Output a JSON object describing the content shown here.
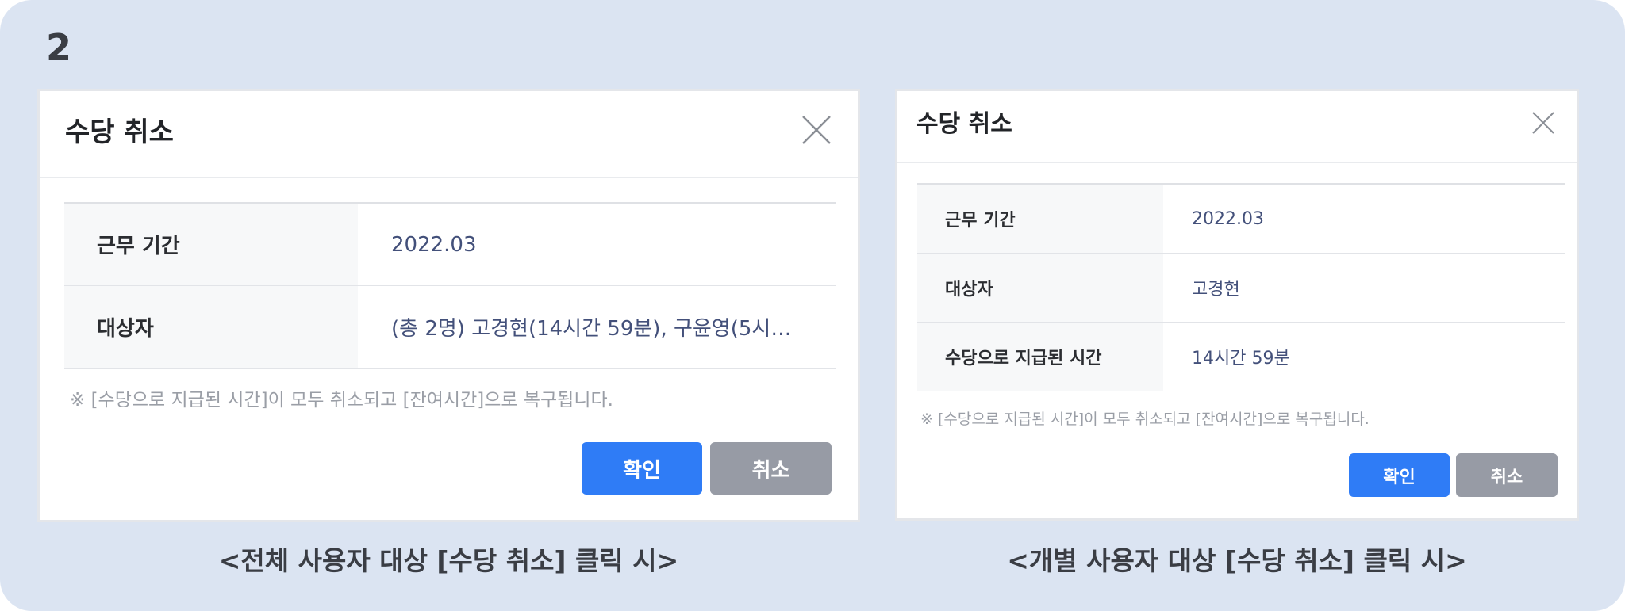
{
  "step_number": "2",
  "dialog_all": {
    "title": "수당 취소",
    "rows": [
      {
        "label": "근무 기간",
        "value": "2022.03"
      },
      {
        "label": "대상자",
        "value": "(총 2명) 고경현(14시간 59분), 구윤영(5시…"
      }
    ],
    "notice": "※ [수당으로 지급된 시간]이 모두 취소되고 [잔여시간]으로 복구됩니다.",
    "confirm_label": "확인",
    "cancel_label": "취소",
    "caption": "<전체 사용자 대상 [수당 취소] 클릭 시>"
  },
  "dialog_individual": {
    "title": "수당 취소",
    "rows": [
      {
        "label": "근무 기간",
        "value": "2022.03"
      },
      {
        "label": "대상자",
        "value": "고경현"
      },
      {
        "label": "수당으로 지급된 시간",
        "value": "14시간 59분"
      }
    ],
    "notice": "※ [수당으로 지급된 시간]이 모두 취소되고 [잔여시간]으로 복구됩니다.",
    "confirm_label": "확인",
    "cancel_label": "취소",
    "caption": "<개별 사용자 대상 [수당 취소] 클릭 시>"
  },
  "colors": {
    "background": "#dbe4f2",
    "primary_button": "#2f7cf6",
    "secondary_button": "#979ba5",
    "value_text": "#43507a"
  },
  "icons": {
    "close": "close-icon"
  }
}
